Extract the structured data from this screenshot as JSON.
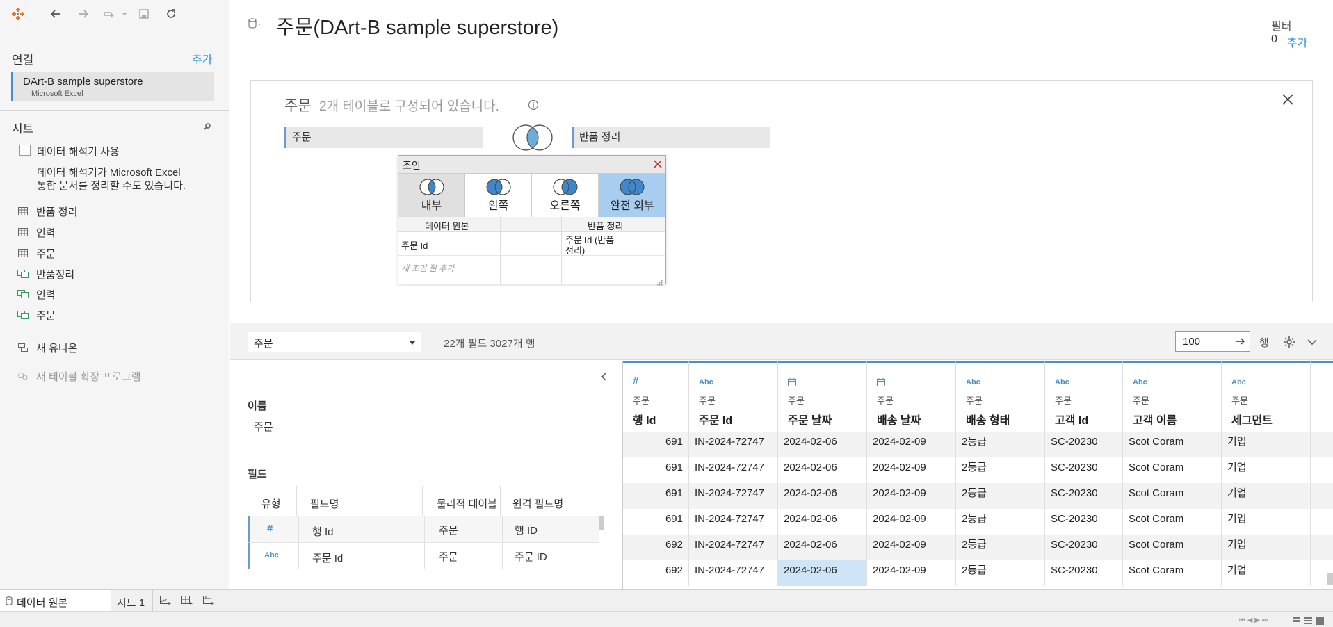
{
  "toolbar": {
    "logo_icon": "tableau-logo-icon",
    "back_icon": "back-arrow-icon",
    "forward_icon": "forward-arrow-icon",
    "redo_icon": "redo-icon",
    "save_icon": "save-icon",
    "refresh_icon": "refresh-icon"
  },
  "connections": {
    "title": "연결",
    "add_label": "추가",
    "source_name": "DArt-B sample superstore",
    "source_type": "Microsoft Excel"
  },
  "sheets": {
    "title": "시트",
    "interpreter_label": "데이터 해석기 사용",
    "interpreter_desc_1": "데이터 해석기가 Microsoft Excel",
    "interpreter_desc_2": "통합 문서를 정리할 수도 있습니다.",
    "items": [
      {
        "label": "반품 정리",
        "icon": "table-icon"
      },
      {
        "label": "인력",
        "icon": "table-icon"
      },
      {
        "label": "주문",
        "icon": "table-icon"
      },
      {
        "label": "반품정리",
        "icon": "named-range-icon"
      },
      {
        "label": "인력",
        "icon": "named-range-icon"
      },
      {
        "label": "주문",
        "icon": "named-range-icon"
      }
    ],
    "new_union": "새 유니온",
    "new_extension": "새 테이블 확장 프로그램"
  },
  "header": {
    "title": "주문(DArt-B sample superstore)",
    "filter_label": "필터",
    "filter_count": "0",
    "filter_add": "추가"
  },
  "canvas": {
    "logical_name": "주문",
    "logical_desc": "2개 테이블로 구성되어 있습니다.",
    "left_table": "주문",
    "right_table": "반품 정리"
  },
  "join": {
    "title": "조인",
    "types": [
      "내부",
      "왼쪽",
      "오른쪽",
      "완전 외부"
    ],
    "selected": "완전 외부",
    "col_left_header": "데이터 원본",
    "col_right_header": "반품 정리",
    "clause_left": "주문 Id",
    "clause_op": "=",
    "clause_right_1": "주문 Id (반품",
    "clause_right_2": "정리)",
    "add_clause": "새 조인 절 추가"
  },
  "midbar": {
    "table_select": "주문",
    "summary": "22개 필드 3027개 행",
    "row_limit": "100",
    "rows_label": "행"
  },
  "meta": {
    "name_label": "이름",
    "name_value": "주문",
    "fields_label": "필드",
    "headers": [
      "유형",
      "필드명",
      "물리적 테이블",
      "원격 필드명"
    ],
    "rows": [
      {
        "type": "#",
        "field": "행 Id",
        "table": "주문",
        "remote": "행 ID"
      },
      {
        "type": "Abc",
        "field": "주문 Id",
        "table": "주문",
        "remote": "주문 ID"
      }
    ]
  },
  "grid": {
    "columns": [
      {
        "type": "#",
        "source": "주문",
        "name": "행 Id"
      },
      {
        "type": "Abc",
        "source": "주문",
        "name": "주문 Id"
      },
      {
        "type": "date",
        "source": "주문",
        "name": "주문 날짜"
      },
      {
        "type": "date",
        "source": "주문",
        "name": "배송 날짜"
      },
      {
        "type": "Abc",
        "source": "주문",
        "name": "배송 형태"
      },
      {
        "type": "Abc",
        "source": "주문",
        "name": "고객 Id"
      },
      {
        "type": "Abc",
        "source": "주문",
        "name": "고객 이름"
      },
      {
        "type": "Abc",
        "source": "주문",
        "name": "세그먼트"
      }
    ],
    "rows": [
      [
        "691",
        "IN-2024-72747",
        "2024-02-06",
        "2024-02-09",
        "2등급",
        "SC-20230",
        "Scot Coram",
        "기업"
      ],
      [
        "691",
        "IN-2024-72747",
        "2024-02-06",
        "2024-02-09",
        "2등급",
        "SC-20230",
        "Scot Coram",
        "기업"
      ],
      [
        "691",
        "IN-2024-72747",
        "2024-02-06",
        "2024-02-09",
        "2등급",
        "SC-20230",
        "Scot Coram",
        "기업"
      ],
      [
        "691",
        "IN-2024-72747",
        "2024-02-06",
        "2024-02-09",
        "2등급",
        "SC-20230",
        "Scot Coram",
        "기업"
      ],
      [
        "692",
        "IN-2024-72747",
        "2024-02-06",
        "2024-02-09",
        "2등급",
        "SC-20230",
        "Scot Coram",
        "기업"
      ],
      [
        "692",
        "IN-2024-72747",
        "2024-02-06",
        "2024-02-09",
        "2등급",
        "SC-20230",
        "Scot Coram",
        "기업"
      ]
    ]
  },
  "tabs": {
    "data_source": "데이터 원본",
    "sheet1": "시트 1"
  },
  "colors": {
    "accent": "#4a90c4",
    "join_selected": "#a9cdef",
    "venn_fill": "#3f87c9"
  }
}
